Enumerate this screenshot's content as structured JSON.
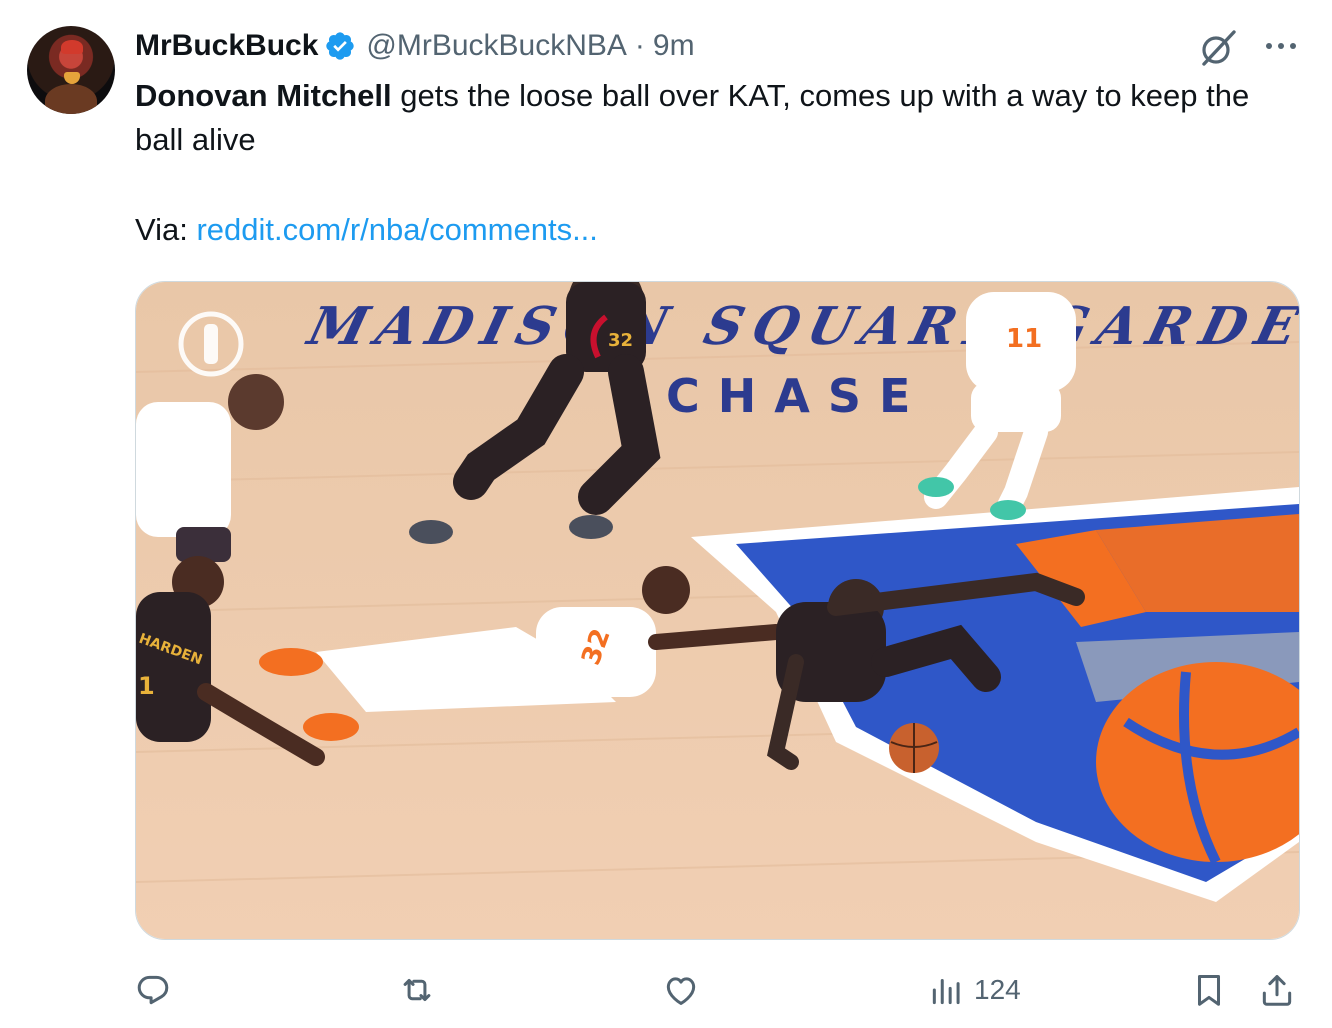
{
  "tweet": {
    "author_name": "MrBuckBuck",
    "author_handle": "@MrBuckBuckNBA",
    "separator": "·",
    "time": "9m",
    "text_bold": "Donovan Mitchell",
    "text_rest": " gets the loose ball over KAT, comes up with a way to keep the ball alive",
    "via_label": "Via: ",
    "via_link": "reddit.com/r/nba/comments...",
    "media_court_text_1": "MADISON SQUARE GARDEN",
    "media_court_text_2": "CHASE",
    "media_jerseys": [
      "32",
      "11",
      "1",
      "32"
    ],
    "media_jersey_name": "HARDEN"
  },
  "stats": {
    "views": "124"
  },
  "icons": {
    "verified": "verified-badge-icon",
    "grok": "grok-icon",
    "more": "more-icon",
    "reply": "reply-icon",
    "retweet": "retweet-icon",
    "like": "like-icon",
    "views": "views-icon",
    "bookmark": "bookmark-icon",
    "share": "share-icon"
  },
  "colors": {
    "accent": "#1d9bf0",
    "secondary_text": "#536471",
    "primary_text": "#0f1419"
  }
}
